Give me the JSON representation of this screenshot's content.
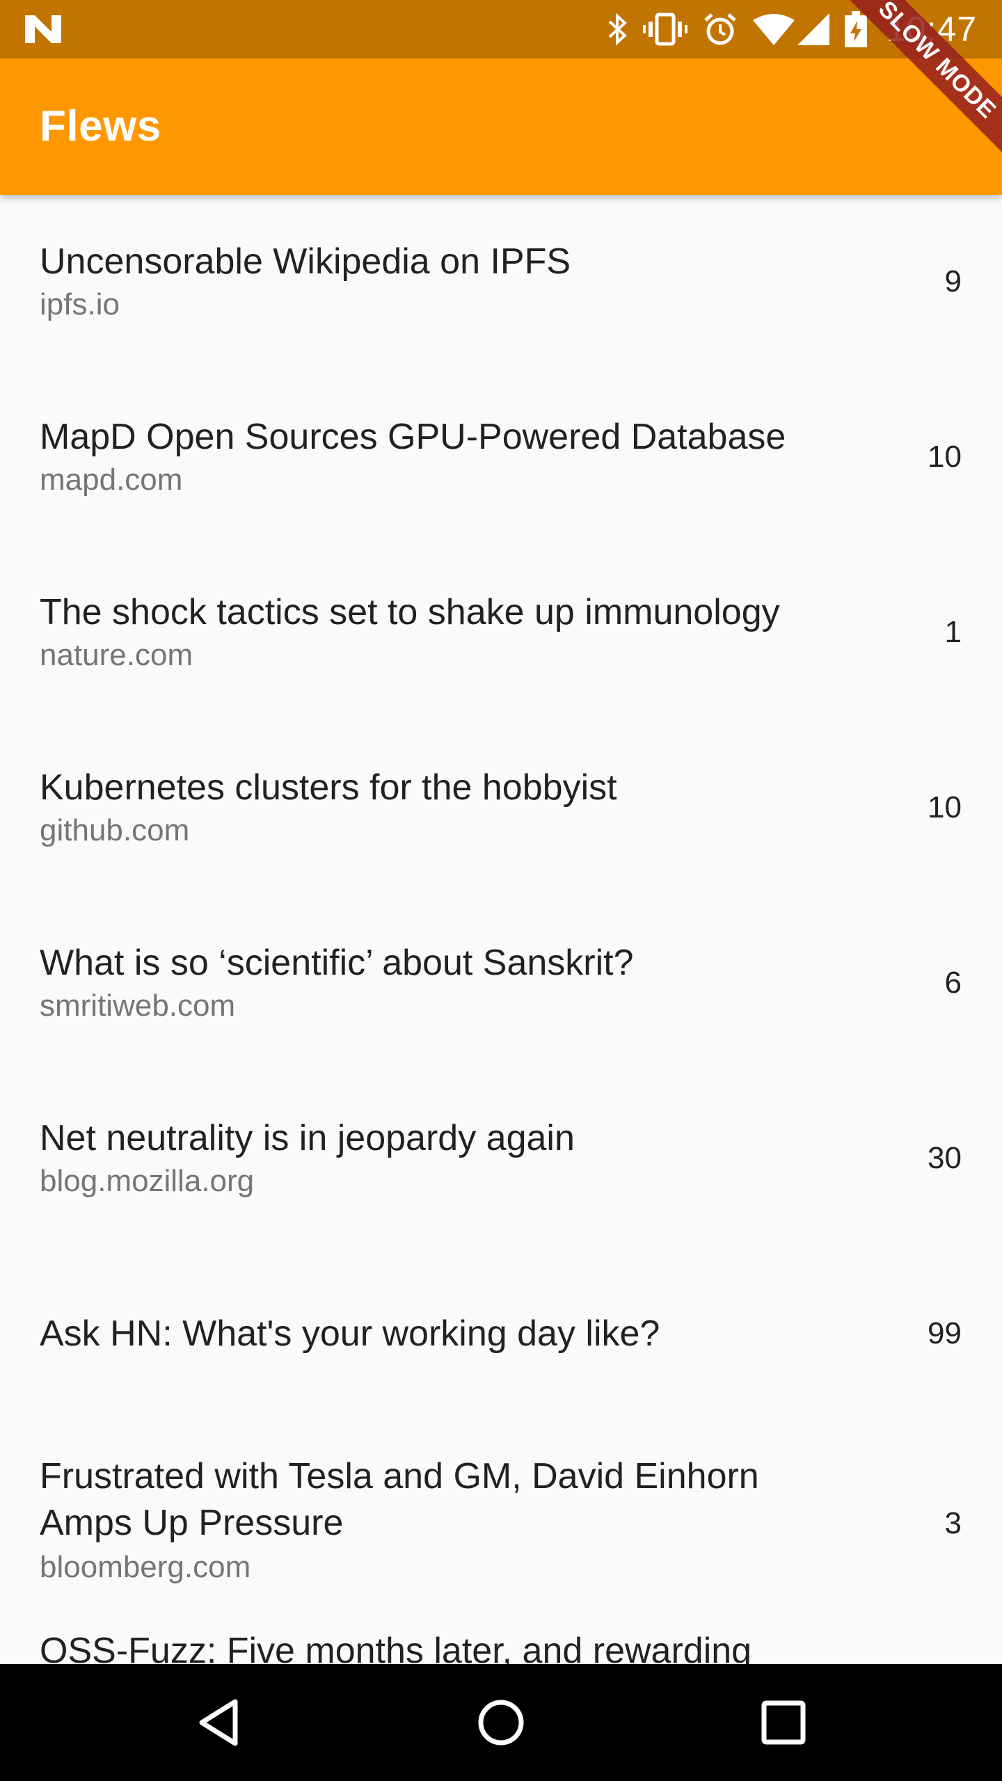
{
  "status_bar": {
    "time": "10:47",
    "icons": [
      "n-logo-icon",
      "bluetooth-icon",
      "vibrate-icon",
      "alarm-icon",
      "wifi-icon",
      "signal-icon",
      "battery-icon"
    ]
  },
  "app_bar": {
    "title": "Flews",
    "color": "#FF9800"
  },
  "banner": {
    "label": "SLOW MODE"
  },
  "stories": [
    {
      "title": "Uncensorable Wikipedia on IPFS",
      "domain": "ipfs.io",
      "score": "9"
    },
    {
      "title": "MapD Open Sources GPU-Powered Database",
      "domain": "mapd.com",
      "score": "10"
    },
    {
      "title": "The shock tactics set to shake up immunology",
      "domain": "nature.com",
      "score": "1"
    },
    {
      "title": "Kubernetes clusters for the hobbyist",
      "domain": "github.com",
      "score": "10"
    },
    {
      "title": "What is so ‘scientific’ about Sanskrit?",
      "domain": "smritiweb.com",
      "score": "6"
    },
    {
      "title": "Net neutrality is in jeopardy again",
      "domain": "blog.mozilla.org",
      "score": "30"
    },
    {
      "title": "Ask HN: What's your working day like?",
      "domain": "",
      "score": "99"
    },
    {
      "title": "Frustrated with Tesla and GM, David Einhorn Amps Up Pressure",
      "domain": "bloomberg.com",
      "score": "3"
    },
    {
      "title": "OSS-Fuzz: Five months later, and rewarding",
      "domain": "",
      "score": ""
    }
  ],
  "nav_bar": {
    "buttons": [
      "back-icon",
      "home-icon",
      "recents-icon"
    ]
  }
}
